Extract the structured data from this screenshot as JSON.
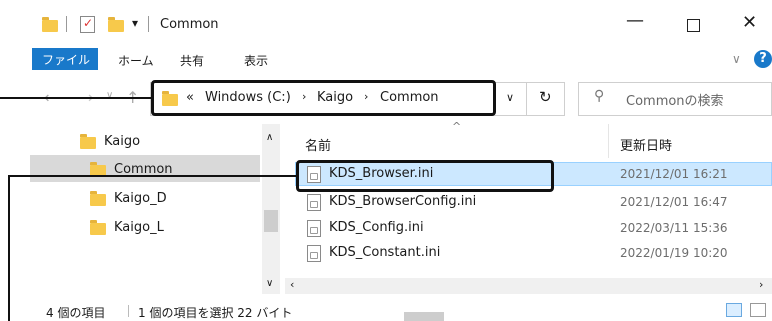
{
  "window": {
    "title": "Common"
  },
  "ribbon": {
    "tabs": [
      "ファイル",
      "ホーム",
      "共有",
      "表示"
    ]
  },
  "address": {
    "overflow": "«",
    "segments": [
      "Windows (C:)",
      "Kaigo",
      "Common"
    ]
  },
  "search": {
    "placeholder": "Commonの検索"
  },
  "tree": {
    "items": [
      "Kaigo",
      "Common",
      "Kaigo_D",
      "Kaigo_L"
    ]
  },
  "columns": {
    "name": "名前",
    "date": "更新日時"
  },
  "files": [
    {
      "name": "KDS_Browser.ini",
      "date": "2021/12/01 16:21"
    },
    {
      "name": "KDS_BrowserConfig.ini",
      "date": "2021/12/01 16:47"
    },
    {
      "name": "KDS_Config.ini",
      "date": "2022/03/11 15:36"
    },
    {
      "name": "KDS_Constant.ini",
      "date": "2022/01/19 10:20"
    }
  ],
  "status": {
    "count": "4 個の項目",
    "selected": "1 個の項目を選択  22 バイト"
  },
  "colors": {
    "accent": "#1979ca",
    "selection": "#cce8ff",
    "tree_selection": "#d9d9d9",
    "folder": "#f7c94b"
  }
}
